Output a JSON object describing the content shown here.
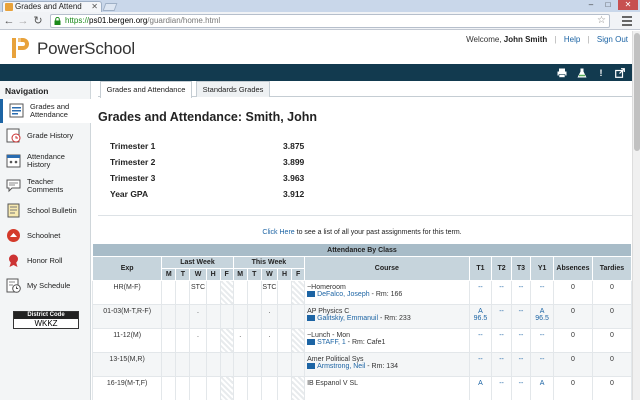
{
  "browser": {
    "tab_title": "Grades and Attend",
    "url_scheme": "https://",
    "url_domain": "ps01.bergen.org",
    "url_path": "/guardian/home.html"
  },
  "header": {
    "logo_text": "PowerSchool",
    "welcome_prefix": "Welcome, ",
    "user_name": "John Smith",
    "help_label": "Help",
    "signout_label": "Sign Out"
  },
  "toolbar": {
    "icons": [
      "printer-icon",
      "flask-icon",
      "alert-icon",
      "external-link-icon"
    ]
  },
  "sidebar": {
    "heading": "Navigation",
    "items": [
      {
        "label": "Grades and Attendance",
        "icon": "grades-icon"
      },
      {
        "label": "Grade History",
        "icon": "grade-history-icon"
      },
      {
        "label": "Attendance History",
        "icon": "attendance-history-icon"
      },
      {
        "label": "Teacher Comments",
        "icon": "teacher-comments-icon"
      },
      {
        "label": "School Bulletin",
        "icon": "bulletin-icon"
      },
      {
        "label": "Schoolnet",
        "icon": "schoolnet-icon"
      },
      {
        "label": "Honor Roll",
        "icon": "honor-roll-icon"
      },
      {
        "label": "My Schedule",
        "icon": "schedule-icon"
      }
    ],
    "district_code_label": "District Code",
    "district_code": "WKKZ"
  },
  "main": {
    "tabs": [
      "Grades and Attendance",
      "Standards Grades"
    ],
    "title": "Grades and Attendance: Smith, John",
    "gpa": [
      {
        "label": "Trimester 1",
        "value": "3.875"
      },
      {
        "label": "Trimester 2",
        "value": "3.899"
      },
      {
        "label": "Trimester 3",
        "value": "3.963"
      },
      {
        "label": "Year GPA",
        "value": "3.912"
      }
    ],
    "click_here": "Click Here",
    "click_rest": " to see a list of all your past assignments for this term."
  },
  "attendance": {
    "caption": "Attendance By Class",
    "headers": {
      "exp": "Exp",
      "last_week": "Last Week",
      "this_week": "This Week",
      "course": "Course",
      "t1": "T1",
      "t2": "T2",
      "t3": "T3",
      "y1": "Y1",
      "absences": "Absences",
      "tardies": "Tardies"
    },
    "days": [
      "M",
      "T",
      "W",
      "H",
      "F",
      "M",
      "T",
      "W",
      "H",
      "F"
    ],
    "rows": [
      {
        "exp": "HR(M-F)",
        "last": [
          "",
          "",
          "STC",
          "",
          ""
        ],
        "this": [
          "",
          "",
          "STC",
          "",
          ""
        ],
        "course": "~Homeroom",
        "teacher": "DeFalco, Joseph",
        "room": " - Rm: 166",
        "t1": "--",
        "t1_pct": "",
        "t2": "--",
        "t3": "--",
        "y1": "--",
        "y1_pct": "",
        "absences": "0",
        "tardies": "0"
      },
      {
        "exp": "01-03(M-T,R-F)",
        "last": [
          "",
          "",
          ".",
          "",
          ""
        ],
        "this": [
          "",
          "",
          ".",
          "",
          ""
        ],
        "course": "AP Physics C",
        "teacher": "Galitskiy, Emmanuil",
        "room": " - Rm: 233",
        "t1": "A",
        "t1_pct": "96.5",
        "t2": "--",
        "t3": "--",
        "y1": "A",
        "y1_pct": "96.5",
        "absences": "0",
        "tardies": "0"
      },
      {
        "exp": "11-12(M)",
        "last": [
          "",
          "",
          ".",
          "",
          ""
        ],
        "this": [
          ".",
          "",
          ".",
          "",
          ""
        ],
        "course": "~Lunch - Mon",
        "teacher": "STAFF, 1",
        "room": " - Rm: Cafe1",
        "t1": "--",
        "t1_pct": "",
        "t2": "--",
        "t3": "--",
        "y1": "--",
        "y1_pct": "",
        "absences": "0",
        "tardies": "0"
      },
      {
        "exp": "13-15(M,R)",
        "last": [
          "",
          "",
          "",
          "",
          ""
        ],
        "this": [
          "",
          "",
          "",
          "",
          ""
        ],
        "course": "Amer Political Sys",
        "teacher": "Armstrong, Neil",
        "room": " - Rm: 134",
        "t1": "--",
        "t1_pct": "",
        "t2": "--",
        "t3": "--",
        "y1": "--",
        "y1_pct": "",
        "absences": "0",
        "tardies": "0"
      },
      {
        "exp": "16-19(M-T,F)",
        "last": [
          "",
          "",
          "",
          "",
          ""
        ],
        "this": [
          "",
          "",
          "",
          "",
          ""
        ],
        "course": "IB Espanol V SL",
        "teacher": "",
        "room": "",
        "t1": "A",
        "t1_pct": "",
        "t2": "--",
        "t3": "--",
        "y1": "A",
        "y1_pct": "",
        "absences": "0",
        "tardies": "0"
      }
    ]
  }
}
